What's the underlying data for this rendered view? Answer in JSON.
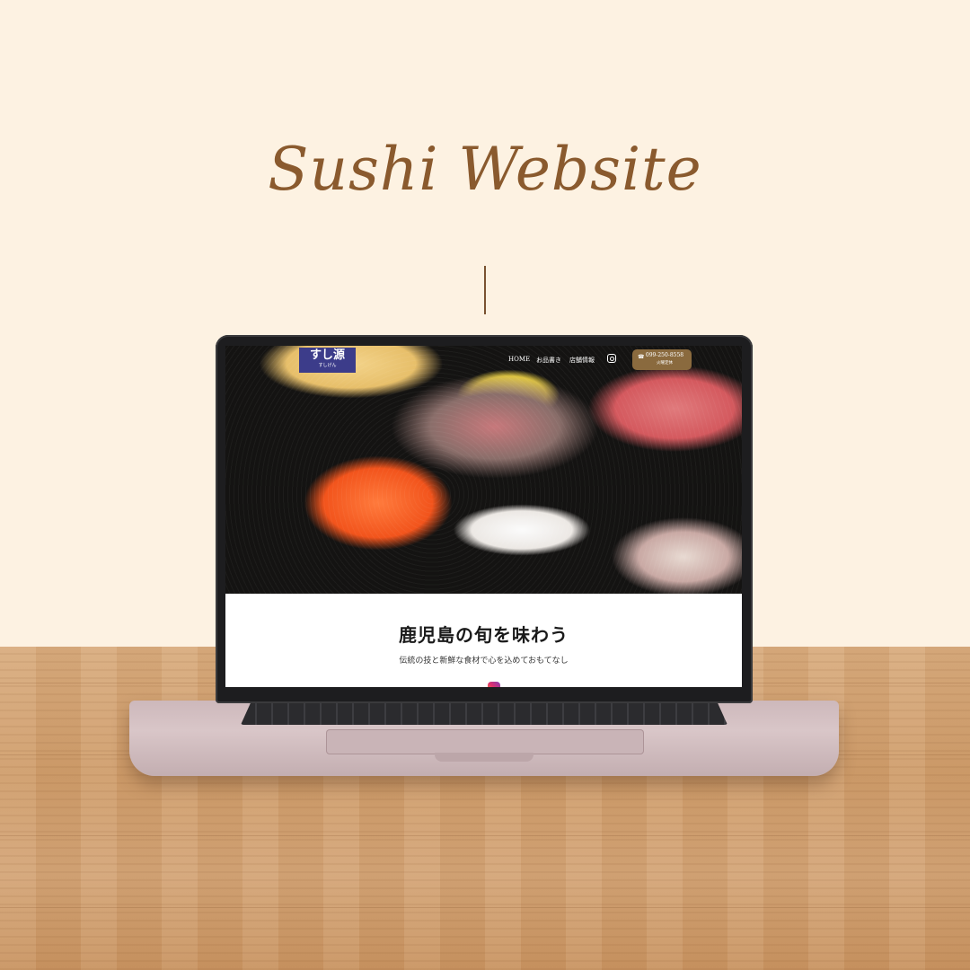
{
  "headline": "Sushi Website",
  "site": {
    "logo_main": "すし源",
    "logo_sub": "すしげん",
    "nav": [
      "HOME",
      "お品書き",
      "店舗情報"
    ],
    "phone": "099-250-8558",
    "phone_note": "火曜定休",
    "title": "鹿児島の旬を味わう",
    "subtitle": "伝統の技と新鮮な食材で心を込めておもてなし"
  },
  "colors": {
    "background": "#fdf2e2",
    "headline": "#8a5a2e",
    "logo_bg": "#3c3c8a",
    "phone_btn": "#8a6a3e"
  },
  "icons": [
    "instagram-icon",
    "phone-icon"
  ]
}
